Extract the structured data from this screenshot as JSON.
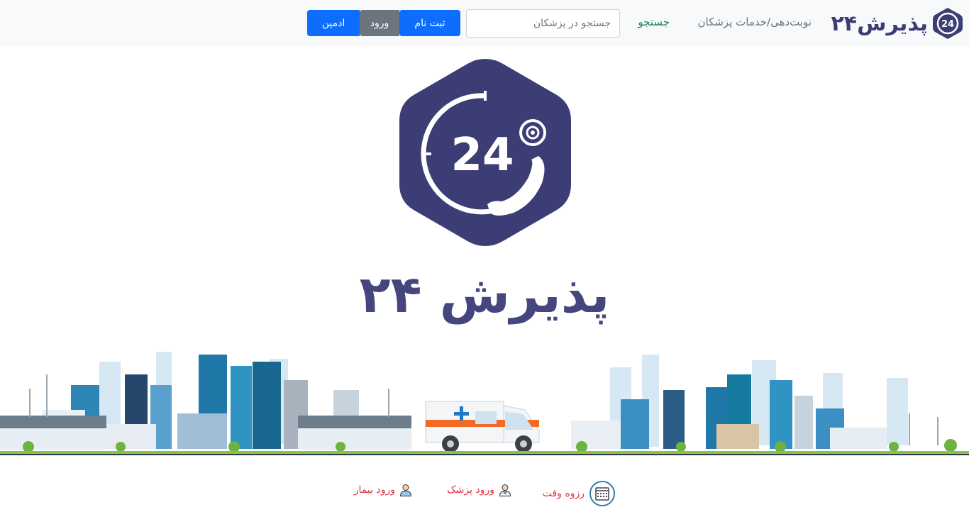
{
  "header": {
    "brand_text": "پذیرش۲۴",
    "brand_logo_text": "24",
    "nav": {
      "services": "نوبت‌دهی/خدمات پزشکان",
      "search": "جستجو"
    },
    "search": {
      "placeholder": "جستجو در پزشکان",
      "value": ""
    },
    "buttons": {
      "register": "ثبت نام",
      "login": "ورود",
      "admin": "ادمین"
    }
  },
  "hero": {
    "logo_text": "24",
    "logo_icon": "clock-phone-icon",
    "title": "پذیرش ۲۴",
    "illustration": "city-skyline-ambulance"
  },
  "bottom_links": {
    "reserve": "رزوه وقت",
    "doctor_login": "ورود پزشک",
    "patient_login": "ورود بیمار"
  },
  "colors": {
    "brand": "#3d3d75",
    "primary": "#0d6efd",
    "secondary": "#6c757d",
    "success": "#198754",
    "danger": "#dc3545",
    "navbar_bg": "#f8f9fa"
  }
}
